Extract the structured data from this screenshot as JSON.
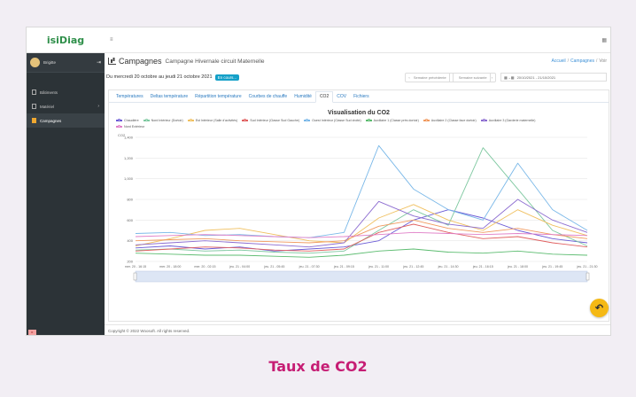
{
  "logo": "isiDiag",
  "user": {
    "name": "Brigitte"
  },
  "sidebar": {
    "items": [
      {
        "label": "Bâtiments"
      },
      {
        "label": "Matériel"
      },
      {
        "label": "Campagnes"
      }
    ]
  },
  "page": {
    "title": "Campagnes",
    "subtitle": "Campagne Hivernale circuit Maternelle",
    "breadcrumb": {
      "home": "Accueil",
      "section": "Campagnes",
      "current": "Voir"
    },
    "period": "Du mercredi 20 octobre au jeudi 21 octobre 2021",
    "status_badge": "En cours...",
    "prev_week": "Semaine précédente",
    "next_week": "Semaine suivante",
    "date_range": "20/10/2021 - 21/10/2021"
  },
  "tabs": [
    {
      "label": "Températures"
    },
    {
      "label": "Deltas température"
    },
    {
      "label": "Répartition température"
    },
    {
      "label": "Courbes de chauffe"
    },
    {
      "label": "Humidité"
    },
    {
      "label": "CO2"
    },
    {
      "label": "COV"
    },
    {
      "label": "Fichiers"
    }
  ],
  "footer": "Copyright © 2022 Woosoft. All rights reserved.",
  "caption": "Taux de CO2",
  "chart_data": {
    "type": "line",
    "title": "Visualisation du CO2",
    "ylabel": "CO2",
    "ylim": [
      200,
      1400
    ],
    "yticks": [
      200,
      400,
      600,
      800,
      1000,
      1200,
      1400
    ],
    "categories": [
      "mer. 20 - 16:15",
      "mer. 20 - 18:00",
      "mer. 20 - 02:15",
      "jeu. 21 - 04:00",
      "jeu. 21 - 05:45",
      "jeu. 21 - 07:30",
      "jeu. 21 - 09:15",
      "jeu. 21 - 11:00",
      "jeu. 21 - 12:45",
      "jeu. 21 - 14:30",
      "jeu. 21 - 16:15",
      "jeu. 21 - 18:00",
      "jeu. 21 - 19:45",
      "jeu. 21 - 21:30"
    ],
    "series": [
      {
        "name": "Chaudière",
        "color": "#6b5bd6",
        "values": [
          330,
          350,
          320,
          340,
          300,
          320,
          340,
          400,
          600,
          700,
          620,
          500,
          420,
          380
        ]
      },
      {
        "name": "Nord Intérieur (Dortoir)",
        "color": "#7ec8a0",
        "values": [
          310,
          320,
          300,
          310,
          290,
          280,
          300,
          500,
          700,
          550,
          1300,
          900,
          500,
          350
        ]
      },
      {
        "name": "Est Intérieur (Salle d'activités)",
        "color": "#f0c060",
        "values": [
          350,
          420,
          500,
          520,
          460,
          400,
          380,
          620,
          750,
          600,
          500,
          700,
          550,
          450
        ]
      },
      {
        "name": "Sud Intérieur (Classe Sud Gauche)",
        "color": "#e06060",
        "values": [
          300,
          320,
          340,
          330,
          310,
          300,
          320,
          480,
          560,
          480,
          420,
          440,
          380,
          340
        ]
      },
      {
        "name": "Ouest Intérieur (Classe Sud droite)",
        "color": "#7ab8e8",
        "values": [
          470,
          480,
          450,
          460,
          440,
          430,
          480,
          1320,
          900,
          700,
          600,
          1150,
          700,
          500
        ]
      },
      {
        "name": "Auxiliaire 1 (Classe près dortoir)",
        "color": "#5cbc70",
        "values": [
          280,
          270,
          260,
          260,
          250,
          240,
          260,
          300,
          320,
          290,
          280,
          300,
          270,
          260
        ]
      },
      {
        "name": "Auxiliaire 2 (Classe face dortoir)",
        "color": "#f09a60",
        "values": [
          400,
          410,
          420,
          400,
          390,
          380,
          400,
          540,
          600,
          520,
          480,
          520,
          460,
          420
        ]
      },
      {
        "name": "Auxiliaire 3 (Garderie maternelle)",
        "color": "#8c6cd0",
        "values": [
          360,
          380,
          400,
          380,
          360,
          340,
          380,
          780,
          640,
          560,
          520,
          800,
          600,
          480
        ]
      },
      {
        "name": "Nord Extérieur",
        "color": "#e080c8",
        "values": [
          440,
          450,
          460,
          450,
          440,
          430,
          440,
          460,
          480,
          470,
          460,
          470,
          460,
          450
        ]
      }
    ]
  }
}
